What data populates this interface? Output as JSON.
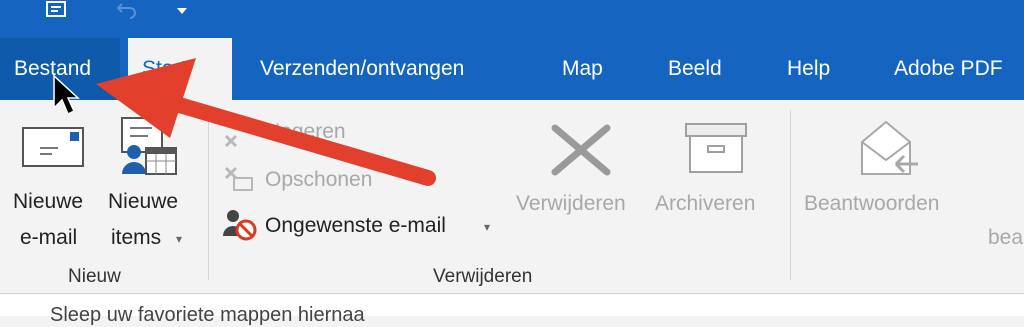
{
  "tabs": [
    {
      "label": "Bestand"
    },
    {
      "label": "Start"
    },
    {
      "label": "Verzenden/ontvangen"
    },
    {
      "label": "Map"
    },
    {
      "label": "Beeld"
    },
    {
      "label": "Help"
    },
    {
      "label": "Adobe PDF"
    }
  ],
  "ribbon": {
    "nieuw": {
      "new_email_line1": "Nieuwe",
      "new_email_line2": "e-mail",
      "new_items_line1": "Nieuwe",
      "new_items_line2": "items",
      "group_label": "Nieuw"
    },
    "verwijderen": {
      "negeren": "Negeren",
      "opschonen": "Opschonen",
      "ongewenste": "Ongewenste e-mail",
      "verwijderen_btn": "Verwijderen",
      "archiveren_btn": "Archiveren",
      "group_label": "Verwijderen"
    },
    "reageren": {
      "beantwoorden": "Beantwoorden",
      "partial_label": "bea"
    }
  },
  "bottom_hint": "Sleep uw favoriete mappen hiernaa",
  "colors": {
    "titlebar": "#1565c0",
    "annotation_arrow": "#e2402c"
  }
}
